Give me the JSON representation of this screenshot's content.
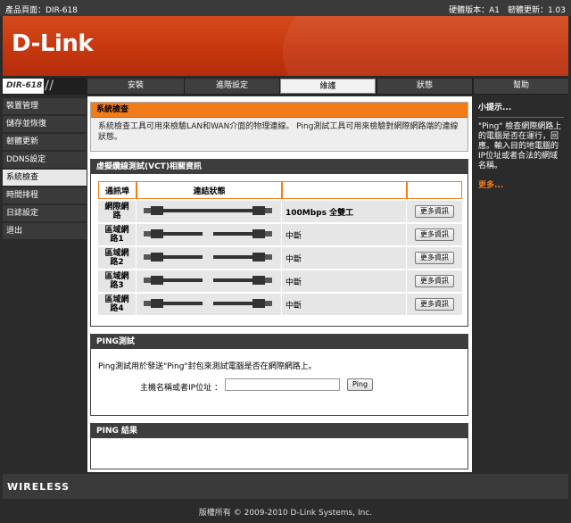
{
  "topbar": {
    "product": "產品頁面：DIR-618",
    "firmware": "硬體版本：A1　韌體更新：1.03"
  },
  "brand": {
    "logo": "D-Link",
    "model": "DIR-618",
    "footer_logo": "WIRELESS",
    "copyright": "版權所有 © 2009-2010 D-Link Systems, Inc."
  },
  "nav": {
    "tabs": [
      {
        "label": "安裝"
      },
      {
        "label": "進階設定"
      },
      {
        "label": "維護"
      },
      {
        "label": "狀態"
      },
      {
        "label": "幫助"
      }
    ]
  },
  "sidebar": {
    "items": [
      {
        "label": "裝置管理"
      },
      {
        "label": "儲存並恢復"
      },
      {
        "label": "韌體更新"
      },
      {
        "label": "DDNS設定"
      },
      {
        "label": "系統檢查"
      },
      {
        "label": "時間排程"
      },
      {
        "label": "日誌設定"
      },
      {
        "label": "退出"
      }
    ]
  },
  "syscheck": {
    "title": "系統檢查",
    "intro": "系統檢查工具可用來檢驗LAN和WAN介面的物理連線。 Ping測試工具可用來檢驗對網際網路端的連線狀態。"
  },
  "vct": {
    "title": "虛擬纜線測試(VCT)相關資訊",
    "col_port": "通訊埠",
    "col_link": "連結狀態",
    "rows": [
      {
        "port1": "網際網",
        "port2": "路",
        "status": "100Mbps 全雙工",
        "connected": true,
        "button": "更多資訊"
      },
      {
        "port1": "區域網",
        "port2": "路1",
        "status": "中斷",
        "connected": false,
        "button": "更多資訊"
      },
      {
        "port1": "區域網",
        "port2": "路2",
        "status": "中斷",
        "connected": false,
        "button": "更多資訊"
      },
      {
        "port1": "區域網",
        "port2": "路3",
        "status": "中斷",
        "connected": false,
        "button": "更多資訊"
      },
      {
        "port1": "區域網",
        "port2": "路4",
        "status": "中斷",
        "connected": false,
        "button": "更多資訊"
      }
    ]
  },
  "ping": {
    "title": "PING測試",
    "desc": "Ping測試用於發送\"Ping\"封包來測試電腦是否在網際網路上。",
    "label": "主機名稱或者IP位址 ：",
    "value": "",
    "button": "Ping"
  },
  "ping_result": {
    "title": "PING 結果"
  },
  "hints": {
    "title": "小提示...",
    "text": "\"Ping\" 檢查網際網路上的電腦是否在運行，回應。輸入目的地電腦的IP位址或者合法的網域名稱。",
    "more": "更多..."
  },
  "colors": {
    "accent": "#f27c1a",
    "banner": "#c7370f",
    "dark": "#2b2b2b"
  }
}
